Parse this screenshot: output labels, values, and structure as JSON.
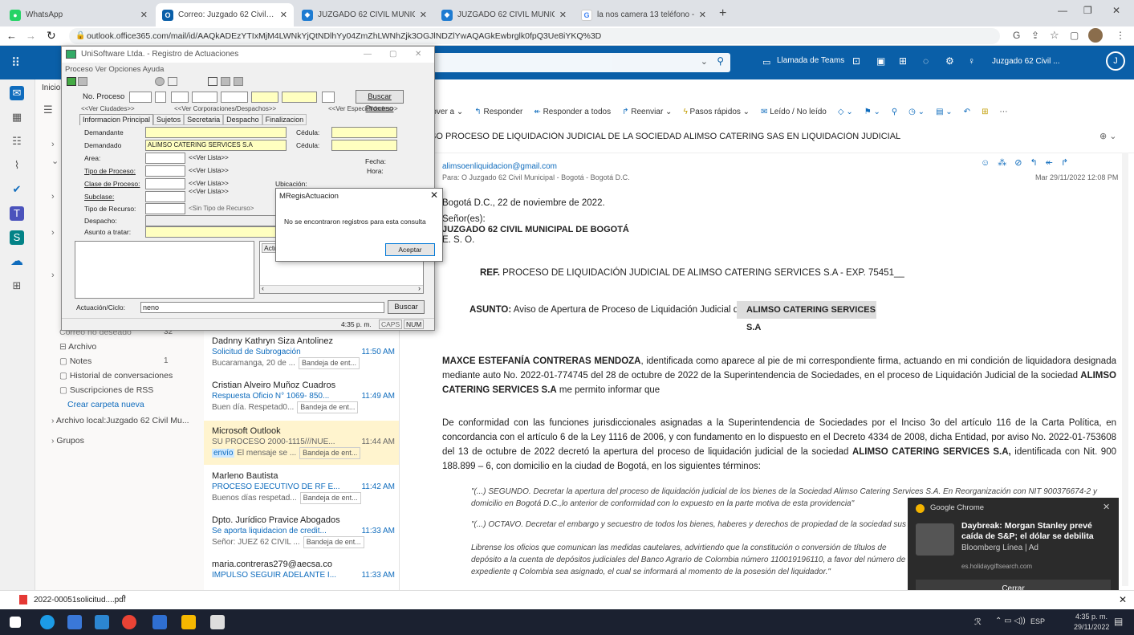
{
  "tabs": [
    {
      "label": "WhatsApp"
    },
    {
      "label": "Correo: Juzgado 62 Civil Munici..."
    },
    {
      "label": "JUZGADO 62 CIVIL MUNICIPAL C..."
    },
    {
      "label": "JUZGADO 62 CIVIL MUNICIPAL C..."
    },
    {
      "label": "la nos camera 13 teléfono - Busca..."
    }
  ],
  "url": "outlook.office365.com/mail/id/AAQkADEzYTIxMjM4LWNkYjQtNDlhYy04ZmZhLWNhZjk3OGJlNDZlYwAQAGkEwbrglk0fpQ3Ue8iYKQ%3D",
  "outlook": {
    "top": {
      "teams_call": "Llamada de Teams",
      "user": "Juzgado 62 Civil ..."
    },
    "cmd": [
      "Mover a",
      "Responder",
      "Responder a todos",
      "Reenviar",
      "Pasos rápidos",
      "Leído / No leído"
    ],
    "folders": [
      "Correo no deseado",
      "Archivo",
      "Notes",
      "Historial de conversaciones",
      "Suscripciones de RSS",
      "Crear carpeta nueva",
      "Archivo local:Juzgado 62 Civil Mu...",
      "Grupos"
    ],
    "folder_counts": {
      "junk": "32",
      "notes": "1"
    },
    "mails": [
      {
        "from": "Dadnny Kathryn Siza Antolinez",
        "subject": "Solicitud de Subrogación",
        "time": "11:50 AM",
        "preview": "Bucaramanga, 20 de ...",
        "tag": "Bandeja de ent..."
      },
      {
        "from": "Cristian Alveiro Muñoz Cuadros",
        "subject": "Respuesta Oficio N° 1069- 850...",
        "time": "11:49 AM",
        "preview": "Buen día. Respetad0...",
        "tag": "Bandeja de ent..."
      },
      {
        "from": "Microsoft Outlook",
        "subject": "SU PROCESO 2000-1115///NUE...",
        "time": "11:44 AM",
        "preview": "El mensaje se ...",
        "tag": "Bandeja de ent...",
        "badge": "envío"
      },
      {
        "from": "Marleno Bautista",
        "subject": "PROCESO EJECUTIVO DE RF E...",
        "time": "11:42 AM",
        "preview": "Buenos días respetad...",
        "tag": "Bandeja de ent..."
      },
      {
        "from": "Dpto. Jurídico Pravice Abogados",
        "subject": "Se aporta liquidacion de credit...",
        "time": "11:33 AM",
        "preview": "Señor: JUEZ 62 CIVIL ...",
        "tag": "Bandeja de ent..."
      },
      {
        "from": "maria.contreras279@aecsa.co",
        "subject": "IMPULSO SEGUIR ADELANTE I...",
        "time": "11:33 AM",
        "preview": "",
        "tag": ""
      }
    ],
    "email": {
      "subject": "SO PROCESO DE LIQUIDACIÓN JUDICIAL DE LA SOCIEDAD ALIMSO CATERING SAS EN LIQUIDACIÓN JUDICIAL",
      "from": "alimsoenliquidacion@gmail.com",
      "to": "Para: O Juzgado 62 Civil Municipal - Bogotá - Bogotá D.C.",
      "date": "Mar 29/11/2022 12:08 PM",
      "place_date": "Bogotá D.C., 22 de noviembre de 2022.",
      "salutation1": "Señor(es):",
      "salutation2": "JUZGADO 62 CIVIL MUNICIPAL DE BOGOTÁ",
      "salutation3": "E. S. O.",
      "ref_label": "REF.",
      "ref_text": "PROCESO DE LIQUIDACIÓN JUDICIAL DE ALIMSO CATERING SERVICES S.A - EXP. 75451__",
      "asunto_label": "ASUNTO:",
      "asunto_text": "Aviso de Apertura de Proceso de Liquidación Judicial de",
      "asunto_highlight": "ALIMSO CATERING SERVICES S.A",
      "p1_name": "MAXCE ESTEFANÍA CONTRERAS MENDOZA",
      "p1_text": ", identificada como aparece al pie de mi correspondiente firma, actuando en mi condición de liquidadora designada mediante auto No. 2022-01-774745 del 28 de octubre de 2022 de la Superintendencia de Sociedades, en el proceso de Liquidación Judicial de la sociedad",
      "p1_company": "ALIMSO CATERING SERVICES S.A",
      "p1_end": " me permito informar que",
      "p2": "De conformidad con las funciones jurisdiccionales asignadas a la Superintendencia de Sociedades por el Inciso 3o del artículo 116 de la Carta Política, en concordancia con el artículo 6 de la Ley 1116 de 2006, y con fundamento en lo dispuesto en el Decreto 4334 de 2008, dicha Entidad, por aviso No. 2022-01-753608 del 13 de octubre de 2022 decretó la apertura del proceso de liquidación judicial de la sociedad",
      "p2_company": "ALIMSO CATERING SERVICES S.A,",
      "p2_end": " identificada con Nit. 900 188.899 – 6, con domicilio en la ciudad de Bogotá, en los siguientes términos:",
      "q1": "\"(...) SEGUNDO. Decretar la apertura del proceso de liquidación judicial de los bienes de la Sociedad Alimso Catering Services S.A. En Reorganización con NIT 900376674-2 y domicilio en Bogotá D.C.,lo anterior de conformidad con lo expuesto en la parte motiva de esta providencia\"",
      "q2": "\"(...) OCTAVO. Decretar el embargo y secuestro de todos los bienes, haberes y derechos de propiedad de la sociedad sus",
      "q3": "Librense los oficios que comunican las medidas cautelares, advirtiendo que la constitución o conversión de títulos de depósito a la cuenta de depósitos judiciales del Banco Agrario de Colombia número 110019196110, a favor del número de expediente q Colombia sea asignado, el cual se informará al momento de la posesión del liquidador.\""
    }
  },
  "uni": {
    "title": "UniSoftware Ltda. - Registro de Actuaciones",
    "menu": "Proceso  Ver  Opciones  Ayuda",
    "no_proceso": "No. Proceso",
    "buscar_proceso": "Buscar Proceso",
    "ver_ciudades": "<<Ver Ciudades>>",
    "ver_corporaciones": "<<Ver Corporaciones/Despachos>>",
    "ver_especialidades": "<<Ver Especialidades>>",
    "tabs": [
      "Informacion Principal",
      "Sujetos",
      "Secretaria",
      "Despacho",
      "Finalizacion"
    ],
    "demandante": "Demandante",
    "demandado": "Demandado",
    "demandado_value": "ALIMSO CATERING SERVICES S.A",
    "cedula": "Cédula:",
    "area": "Area:",
    "tipo_proceso": "Tipo de Proceso:",
    "clase_proceso": "Clase de Proceso:",
    "subclase": "Subclase:",
    "tipo_recurso": "Tipo de Recurso:",
    "despacho": "Despacho:",
    "asunto_tratar": "Asunto a tratar:",
    "ver_lista": "<<Ver Lista>>",
    "sin_tipo_recurso": "<Sin Tipo de Recurso>",
    "fecha": "Fecha:",
    "hora": "Hora:",
    "ubicacion": "Ubicación:",
    "actuacion_label": "Actuación/Ciclo:",
    "actuacion_value": "neno",
    "buscar": "Buscar",
    "status_time": "4:35 p. m.",
    "status_caps": "CAPS",
    "status_num": "NUM",
    "act_col": "Actu"
  },
  "dialog": {
    "title": "MRegisActuacion",
    "message": "No se encontraron registros para esta consulta",
    "ok": "Aceptar"
  },
  "toast": {
    "app": "Google Chrome",
    "title": "Daybreak: Morgan Stanley prevé caída de S&P; el dólar se debilita",
    "source": "Bloomberg Línea | Ad",
    "site": "es.holidaygiftsearch.com",
    "close": "Cerrar"
  },
  "download": {
    "file": "2022-00051solicitud....pdf"
  },
  "taskbar": {
    "lang": "ESP",
    "time": "4:35 p. m.",
    "date": "29/11/2022"
  }
}
